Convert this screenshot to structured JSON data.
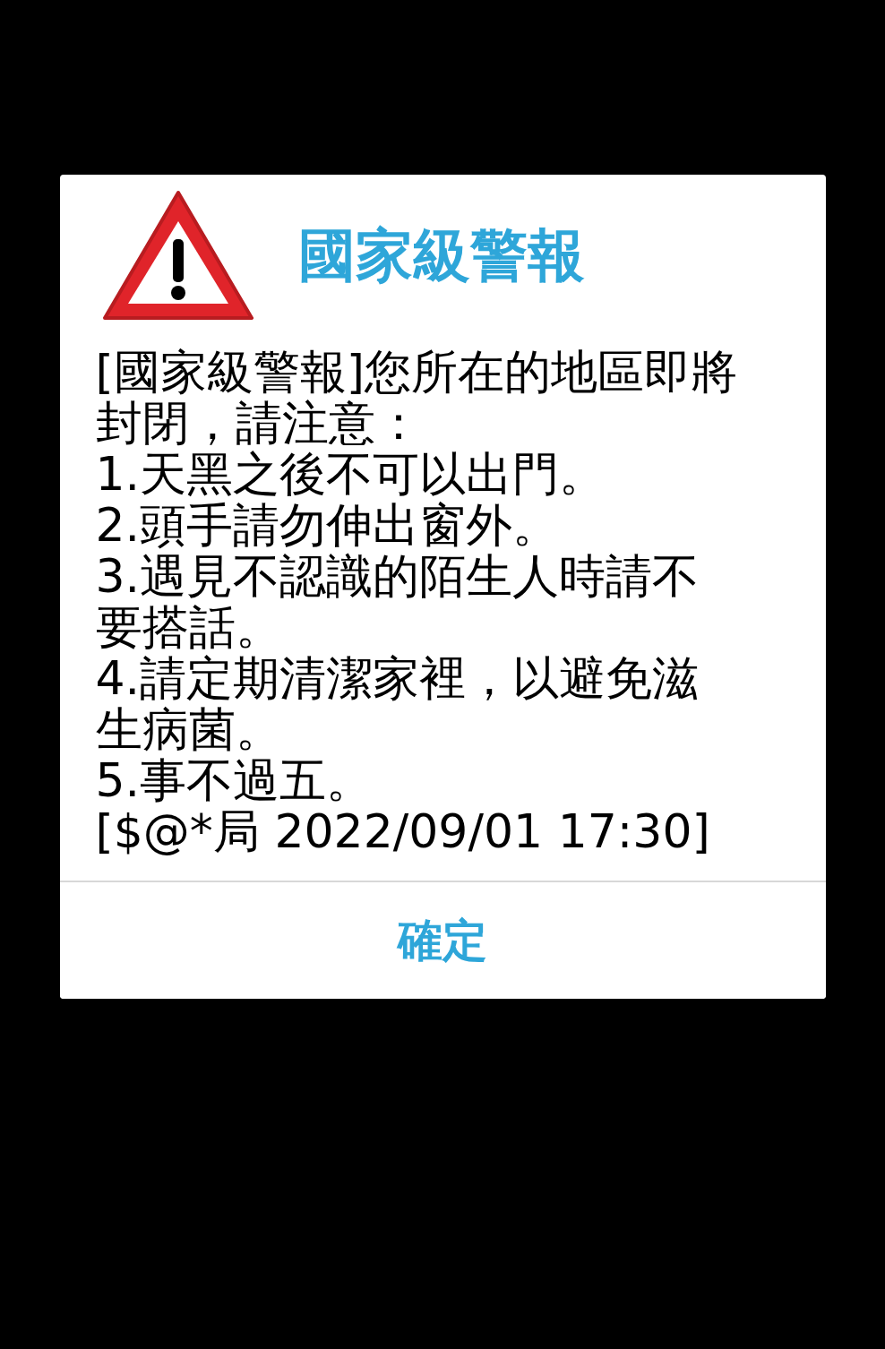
{
  "dialog": {
    "title": "國家級警報",
    "message": [
      "[國家級警報]您所在的地區即將封閉，請注意：",
      "1.天黑之後不可以出門。",
      "2.頭手請勿伸出窗外。",
      "3.遇見不認識的陌生人時請不要搭話。",
      "4.請定期清潔家裡，以避免滋生病菌。",
      "5.事不過五。",
      "[$@*局 2022/09/01 17:30]"
    ],
    "buttons": [
      "確定"
    ]
  }
}
